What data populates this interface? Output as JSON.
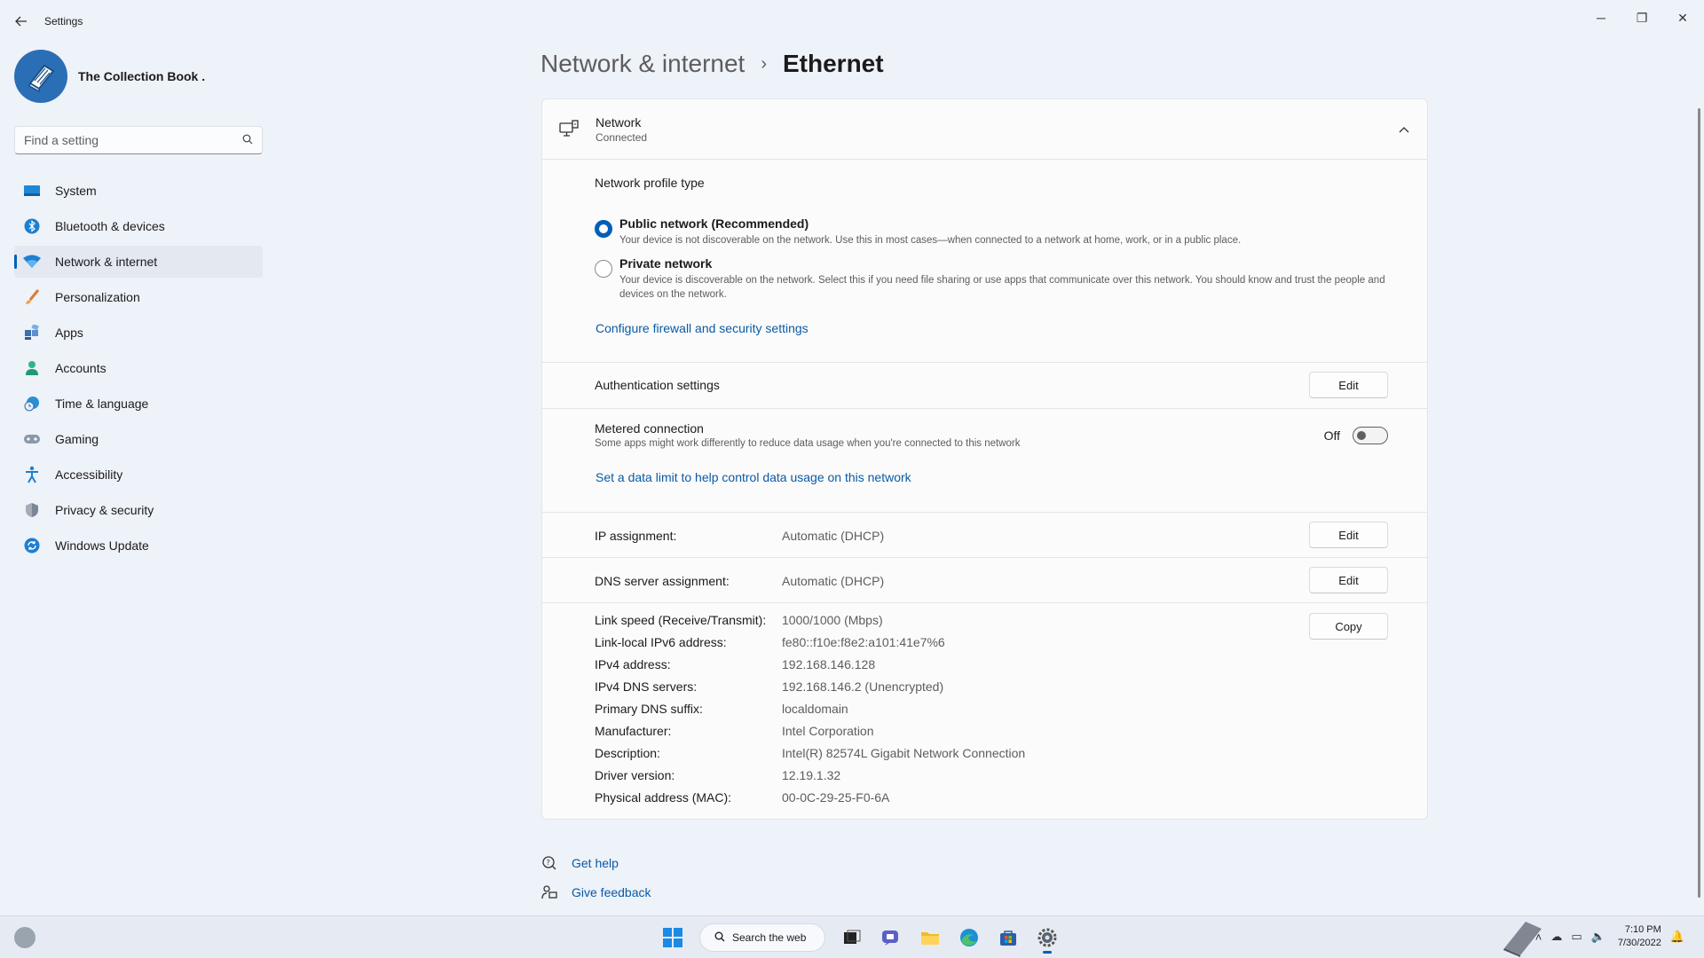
{
  "app": {
    "title": "Settings"
  },
  "window_controls": {
    "minimize": "─",
    "restore": "❐",
    "close": "✕"
  },
  "profile": {
    "name": "The Collection Book ."
  },
  "search": {
    "placeholder": "Find a setting"
  },
  "sidebar": {
    "items": [
      {
        "label": "System",
        "icon": "system-icon"
      },
      {
        "label": "Bluetooth & devices",
        "icon": "bluetooth-icon"
      },
      {
        "label": "Network & internet",
        "icon": "wifi-icon",
        "active": true
      },
      {
        "label": "Personalization",
        "icon": "brush-icon"
      },
      {
        "label": "Apps",
        "icon": "apps-icon"
      },
      {
        "label": "Accounts",
        "icon": "account-icon"
      },
      {
        "label": "Time & language",
        "icon": "clock-globe-icon"
      },
      {
        "label": "Gaming",
        "icon": "gamepad-icon"
      },
      {
        "label": "Accessibility",
        "icon": "accessibility-icon"
      },
      {
        "label": "Privacy & security",
        "icon": "shield-icon"
      },
      {
        "label": "Windows Update",
        "icon": "update-icon"
      }
    ]
  },
  "breadcrumb": {
    "parent": "Network & internet",
    "separator": "›",
    "current": "Ethernet"
  },
  "network": {
    "title": "Network",
    "status": "Connected",
    "profile_type_title": "Network profile type",
    "public": {
      "label": "Public network (Recommended)",
      "desc": "Your device is not discoverable on the network. Use this in most cases—when connected to a network at home, work, or in a public place.",
      "selected": true
    },
    "private": {
      "label": "Private network",
      "desc": "Your device is discoverable on the network. Select this if you need file sharing or use apps that communicate over this network. You should know and trust the people and devices on the network.",
      "selected": false
    },
    "firewall_link": "Configure firewall and security settings"
  },
  "auth": {
    "label": "Authentication settings",
    "button": "Edit"
  },
  "metered": {
    "label": "Metered connection",
    "desc": "Some apps might work differently to reduce data usage when you're connected to this network",
    "state": "Off",
    "link": "Set a data limit to help control data usage on this network"
  },
  "ip": {
    "label": "IP assignment:",
    "value": "Automatic (DHCP)",
    "button": "Edit"
  },
  "dns": {
    "label": "DNS server assignment:",
    "value": "Automatic (DHCP)",
    "button": "Edit"
  },
  "properties": {
    "copy_button": "Copy",
    "rows": [
      {
        "key": "Link speed (Receive/Transmit):",
        "value": "1000/1000 (Mbps)"
      },
      {
        "key": "Link-local IPv6 address:",
        "value": "fe80::f10e:f8e2:a101:41e7%6"
      },
      {
        "key": "IPv4 address:",
        "value": "192.168.146.128"
      },
      {
        "key": "IPv4 DNS servers:",
        "value": "192.168.146.2 (Unencrypted)"
      },
      {
        "key": "Primary DNS suffix:",
        "value": "localdomain"
      },
      {
        "key": "Manufacturer:",
        "value": "Intel Corporation"
      },
      {
        "key": "Description:",
        "value": "Intel(R) 82574L Gigabit Network Connection"
      },
      {
        "key": "Driver version:",
        "value": "12.19.1.32"
      },
      {
        "key": "Physical address (MAC):",
        "value": "00-0C-29-25-F0-6A"
      }
    ]
  },
  "help": {
    "get_help": "Get help",
    "feedback": "Give feedback"
  },
  "taskbar": {
    "search_label": "Search the web",
    "time": "7:10 PM",
    "date": "7/30/2022"
  },
  "colors": {
    "accent": "#005fb8",
    "link": "#0a5aa6",
    "background": "#eef2f9"
  }
}
